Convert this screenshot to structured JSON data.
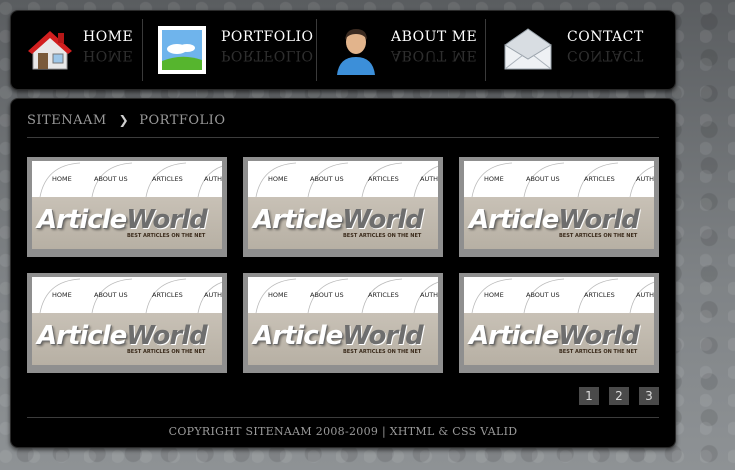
{
  "nav": {
    "items": [
      {
        "label": "HOME",
        "icon": "house-icon"
      },
      {
        "label": "PORTFOLIO",
        "icon": "landscape-picture-icon"
      },
      {
        "label": "ABOUT ME",
        "icon": "person-avatar-icon"
      },
      {
        "label": "CONTACT",
        "icon": "envelope-icon"
      }
    ]
  },
  "breadcrumb": {
    "root": "SITENAAM",
    "separator": "❯",
    "current": "PORTFOLIO"
  },
  "portfolio": {
    "thumb_menu": [
      "HOME",
      "ABOUT US",
      "ARTICLES",
      "AUTH"
    ],
    "thumb_logo_part1": "Article",
    "thumb_logo_part2": "World",
    "thumb_tagline": "BEST ARTICLES ON THE NET"
  },
  "pagination": [
    "1",
    "2",
    "3"
  ],
  "footer": {
    "text": "COPYRIGHT SITENAAM 2008-2009 | XHTML & CSS VALID"
  },
  "colors": {
    "panel": "#000000",
    "thumb_frame": "#8f8f8f",
    "text_muted": "#9a9a9a",
    "pager_bg": "#4a4a4a"
  }
}
